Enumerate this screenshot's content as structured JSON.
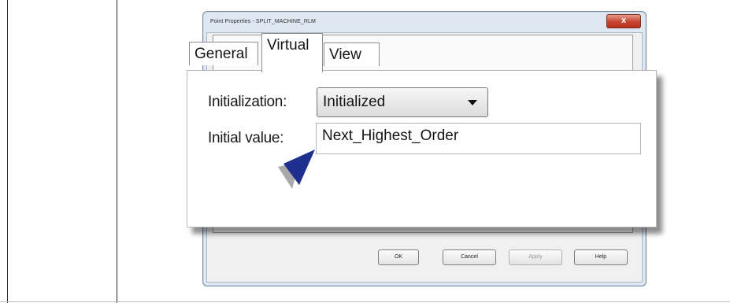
{
  "dialog": {
    "title": "Point Properties - SPLIT_MACHINE_RLM",
    "close_label": "x",
    "buttons": {
      "ok": "OK",
      "cancel": "Cancel",
      "apply": "Apply",
      "help": "Help"
    }
  },
  "tabs": [
    {
      "label": "General"
    },
    {
      "label": "Virtual",
      "active": true
    },
    {
      "label": "View"
    }
  ],
  "fields": {
    "initialization": {
      "label": "Initialization:",
      "value": "Initialized"
    },
    "initial_value": {
      "label": "Initial value:",
      "value": "Next_Highest_Order"
    }
  },
  "colors": {
    "pointer": "#1f2f8f",
    "close_button": "#c6442f"
  },
  "icons": {
    "pointer": "pointer-arrow-icon",
    "dropdown": "chevron-down-icon"
  }
}
